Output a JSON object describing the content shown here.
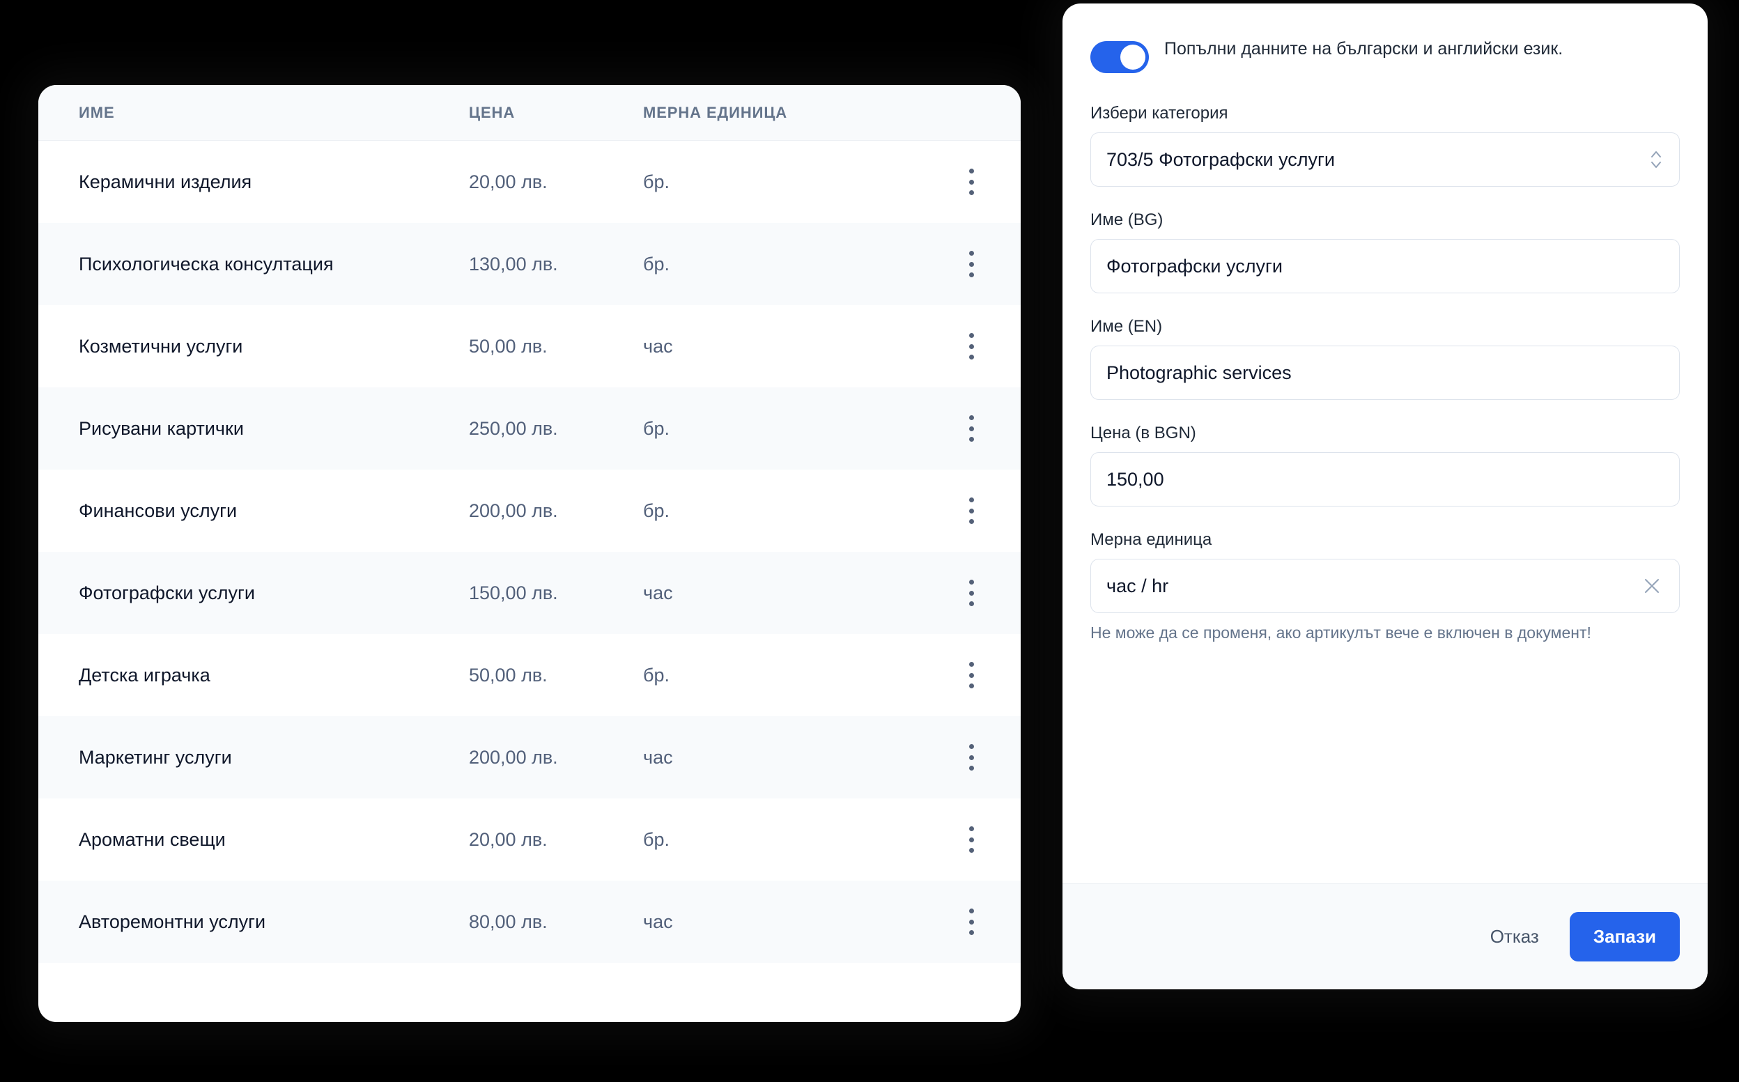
{
  "table": {
    "columns": [
      "ИМЕ",
      "ЦЕНА",
      "МЕРНА ЕДИНИЦА"
    ],
    "rows": [
      {
        "name": "Керамични изделия",
        "price": "20,00 лв.",
        "unit": "бр."
      },
      {
        "name": "Психологическа консултация",
        "price": "130,00 лв.",
        "unit": "бр."
      },
      {
        "name": "Козметични услуги",
        "price": "50,00 лв.",
        "unit": "час"
      },
      {
        "name": "Рисувани картички",
        "price": "250,00 лв.",
        "unit": "бр."
      },
      {
        "name": "Финансови услуги",
        "price": "200,00 лв.",
        "unit": "бр."
      },
      {
        "name": "Фотографски услуги",
        "price": "150,00 лв.",
        "unit": "час"
      },
      {
        "name": "Детска играчка",
        "price": "50,00 лв.",
        "unit": "бр."
      },
      {
        "name": "Маркетинг услуги",
        "price": "200,00 лв.",
        "unit": "час"
      },
      {
        "name": "Ароматни свещи",
        "price": "20,00 лв.",
        "unit": "бр."
      },
      {
        "name": "Авторемонтни услуги",
        "price": "80,00 лв.",
        "unit": "час"
      }
    ],
    "row_menu_icon": "kebab-menu-icon"
  },
  "form": {
    "bilingual_toggle": {
      "label": "Попълни данните на български и английски език.",
      "state": "on"
    },
    "category": {
      "label": "Избери категория",
      "value": "703/5 Фотографски услуги",
      "icon": "chevron-up-down-icon"
    },
    "name_bg": {
      "label": "Име (BG)",
      "value": "Фотографски услуги"
    },
    "name_en": {
      "label": "Име (EN)",
      "value": "Photographic services"
    },
    "price": {
      "label": "Цена (в BGN)",
      "value": "150,00"
    },
    "unit": {
      "label": "Мерна единица",
      "value": "час / hr",
      "clear_icon": "close-icon",
      "help": "Не може да се променя, ако артикулът вече е включен в документ!"
    },
    "footer": {
      "cancel_label": "Отказ",
      "save_label": "Запази"
    }
  },
  "colors": {
    "accent": "#2563eb",
    "card_bg": "#ffffff",
    "row_alt_bg": "#f8fafc",
    "header_text": "#64748b",
    "primary_text": "#0f172a",
    "muted_text": "#52607a",
    "page_bg": "#000000"
  }
}
